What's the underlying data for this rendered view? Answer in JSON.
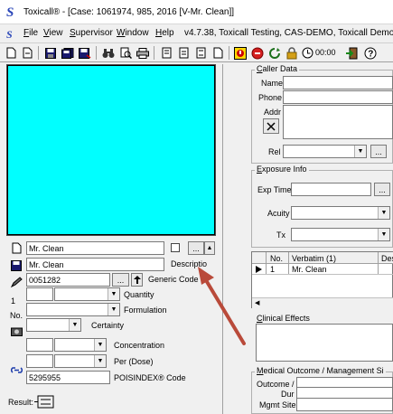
{
  "window": {
    "title": "Toxicall® - [Case: 1061974, 985, 2016 [V-Mr. Clean]]",
    "app_icon": "S"
  },
  "menu": {
    "items": [
      {
        "label": "File",
        "accel": "F"
      },
      {
        "label": "View",
        "accel": "V"
      },
      {
        "label": "Supervisor",
        "accel": "S"
      },
      {
        "label": "Window",
        "accel": "W"
      },
      {
        "label": "Help",
        "accel": "H"
      }
    ],
    "version_info": "v4.7.38, Toxicall Testing, CAS-DEMO, Toxicall Demo"
  },
  "toolbar": {
    "timer": "00:00"
  },
  "left_panel": {
    "image_area_color": "#00ffff",
    "substance_name": "Mr. Clean",
    "product_name": "Mr. Clean",
    "code": "0051282",
    "generic_code_label": "Generic Code",
    "description_label": "Descriptio",
    "browse_label": "...",
    "quantity_label": "Quantity",
    "formulation_label": "Formulation",
    "certainty_label": "Certainty",
    "concentration_label": "Concentration",
    "per_dose_label": "Per (Dose)",
    "poisindex_code": "5295955",
    "poisindex_label": "POISINDEX® Code",
    "quantity_value": "1",
    "number_label": "No.",
    "result_label": "Result:"
  },
  "right_panel": {
    "caller_data": {
      "title": "Caller Data",
      "accel": "C",
      "name_label": "Name",
      "phone_label": "Phone",
      "addr_label": "Addr",
      "rel_label": "Rel",
      "rel_browse": "..."
    },
    "exposure_info": {
      "title": "Exposure Info",
      "accel": "E",
      "exp_time_label": "Exp Time",
      "acuity_label": "Acuity",
      "tx_label": "Tx",
      "browse": "..."
    },
    "substances_grid": {
      "columns": [
        "No.",
        "Verbatim (1)",
        "Des"
      ],
      "rows": [
        {
          "no": "1",
          "verbatim": "Mr. Clean"
        }
      ]
    },
    "clinical_effects": {
      "title": "Clinical Effects",
      "accel": "C"
    },
    "medical_outcome": {
      "title": "Medical Outcome / Management Si",
      "accel": "M",
      "outcome_label": "Outcome /",
      "dur_label": "Dur",
      "mgmt_site_label": "Mgmt Site"
    }
  },
  "colors": {
    "annotation_arrow": "#b94a3a",
    "selection": "#000080"
  }
}
